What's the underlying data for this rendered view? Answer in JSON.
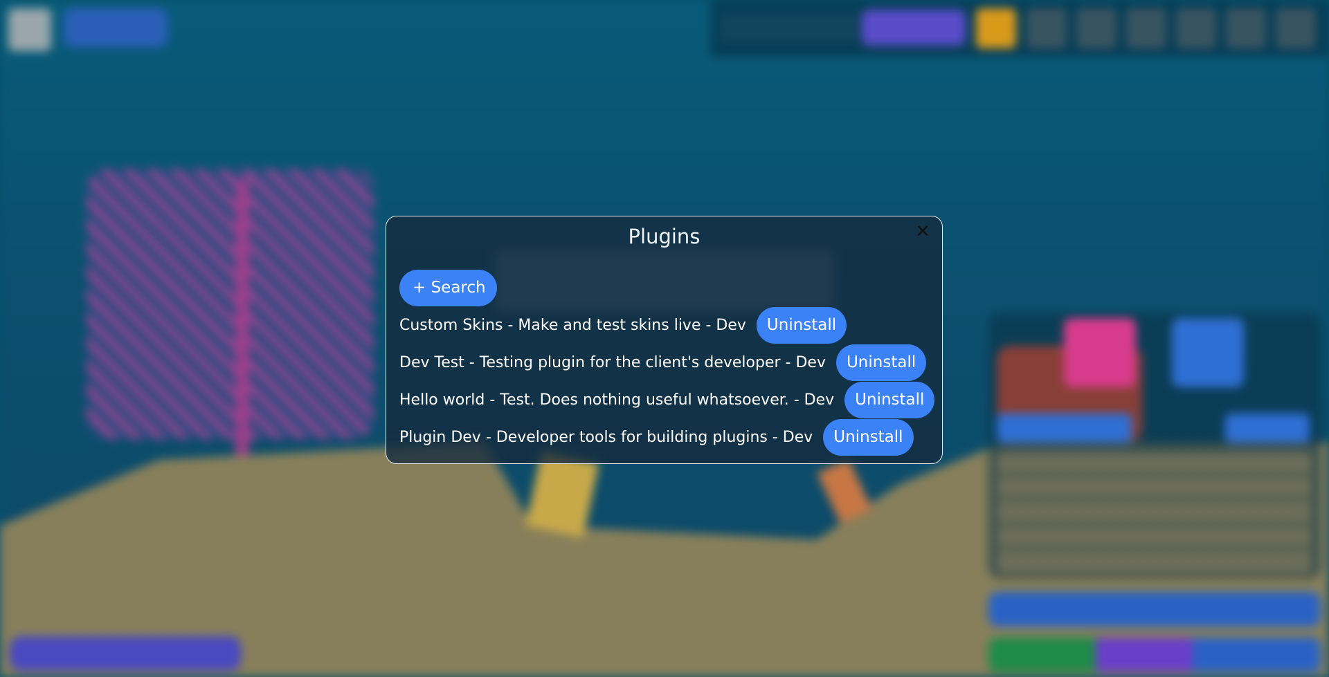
{
  "modal": {
    "title": "Plugins",
    "close_symbol": "✕",
    "search_label": "+ Search"
  },
  "plugins": [
    {
      "text": "Custom Skins - Make and test skins live - Dev",
      "action": "Uninstall"
    },
    {
      "text": "Dev Test - Testing plugin for the client's developer - Dev",
      "action": "Uninstall"
    },
    {
      "text": "Hello world - Test. Does nothing useful whatsoever. - Dev",
      "action": "Uninstall"
    },
    {
      "text": "Plugin Dev - Developer tools for building plugins - Dev",
      "action": "Uninstall"
    }
  ],
  "colors": {
    "button": "#3b82f6",
    "modal_background": "#142a3e",
    "modal_border": "#e8eef2"
  }
}
